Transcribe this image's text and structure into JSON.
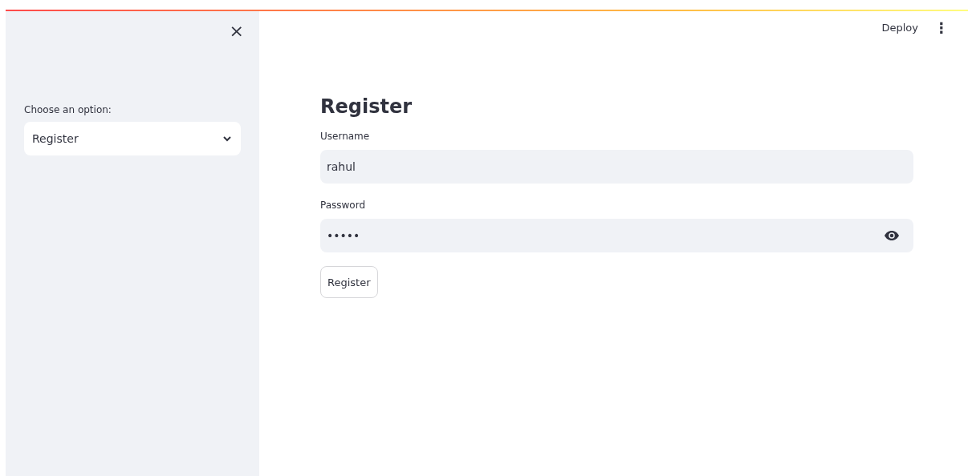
{
  "sidebar": {
    "close": "×",
    "select_label": "Choose an option:",
    "select_value": "Register"
  },
  "header": {
    "deploy": "Deploy",
    "menu": "⋮"
  },
  "form": {
    "title": "Register",
    "fields": [
      {
        "label": "Username",
        "value": "rahul",
        "kind": "text"
      },
      {
        "label": "Password",
        "value": "•••••",
        "kind": "password"
      }
    ],
    "button": "Register"
  }
}
